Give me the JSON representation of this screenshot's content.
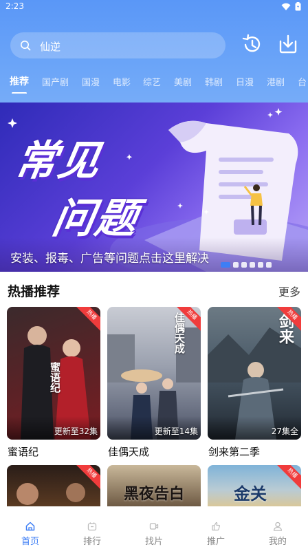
{
  "status_bar": {
    "time": "2:23"
  },
  "search": {
    "text": "仙逆"
  },
  "tabs": [
    "推荐",
    "国产剧",
    "国漫",
    "电影",
    "综艺",
    "美剧",
    "韩剧",
    "日漫",
    "港剧",
    "台"
  ],
  "active_tab": 0,
  "banner": {
    "title_line1": "常见",
    "title_line2": "问题",
    "caption": "安装、报毒、广告等问题点击这里解决",
    "slide_count": 6,
    "active_slide": 0
  },
  "section": {
    "title": "热播推荐",
    "more": "更多"
  },
  "cards": [
    {
      "title": "蜜语纪",
      "episode": "更新至32集",
      "badge": "热播",
      "poster_text": "蜜语纪",
      "colors": [
        "#3b2a2c",
        "#7a1d22"
      ]
    },
    {
      "title": "佳偶天成",
      "episode": "更新至14集",
      "badge": "热播",
      "poster_text": "佳偶天成",
      "colors": [
        "#b7bac4",
        "#4b5266"
      ]
    },
    {
      "title": "剑来第二季",
      "episode": "27集全",
      "badge": "热播",
      "poster_text": "剑来",
      "colors": [
        "#4a5a68",
        "#222a33"
      ]
    }
  ],
  "cards_row2": [
    {
      "badge": "热播",
      "poster_text": "",
      "colors": [
        "#2a1d18",
        "#5a3a22"
      ]
    },
    {
      "badge": "",
      "poster_text": "黑夜告白",
      "colors": [
        "#c9b89a",
        "#6e5a44"
      ]
    },
    {
      "badge": "热播",
      "poster_text": "金关",
      "colors": [
        "#7fb3d8",
        "#d8c79a"
      ]
    }
  ],
  "nav": [
    {
      "label": "首页",
      "icon": "home-icon",
      "active": true
    },
    {
      "label": "排行",
      "icon": "ranking-icon",
      "active": false
    },
    {
      "label": "找片",
      "icon": "find-video-icon",
      "active": false
    },
    {
      "label": "推广",
      "icon": "promote-icon",
      "active": false
    },
    {
      "label": "我的",
      "icon": "profile-icon",
      "active": false
    }
  ],
  "colors": {
    "accent": "#3d7ef5",
    "header_top": "#5a97f7",
    "badge": "#f03c3c"
  }
}
